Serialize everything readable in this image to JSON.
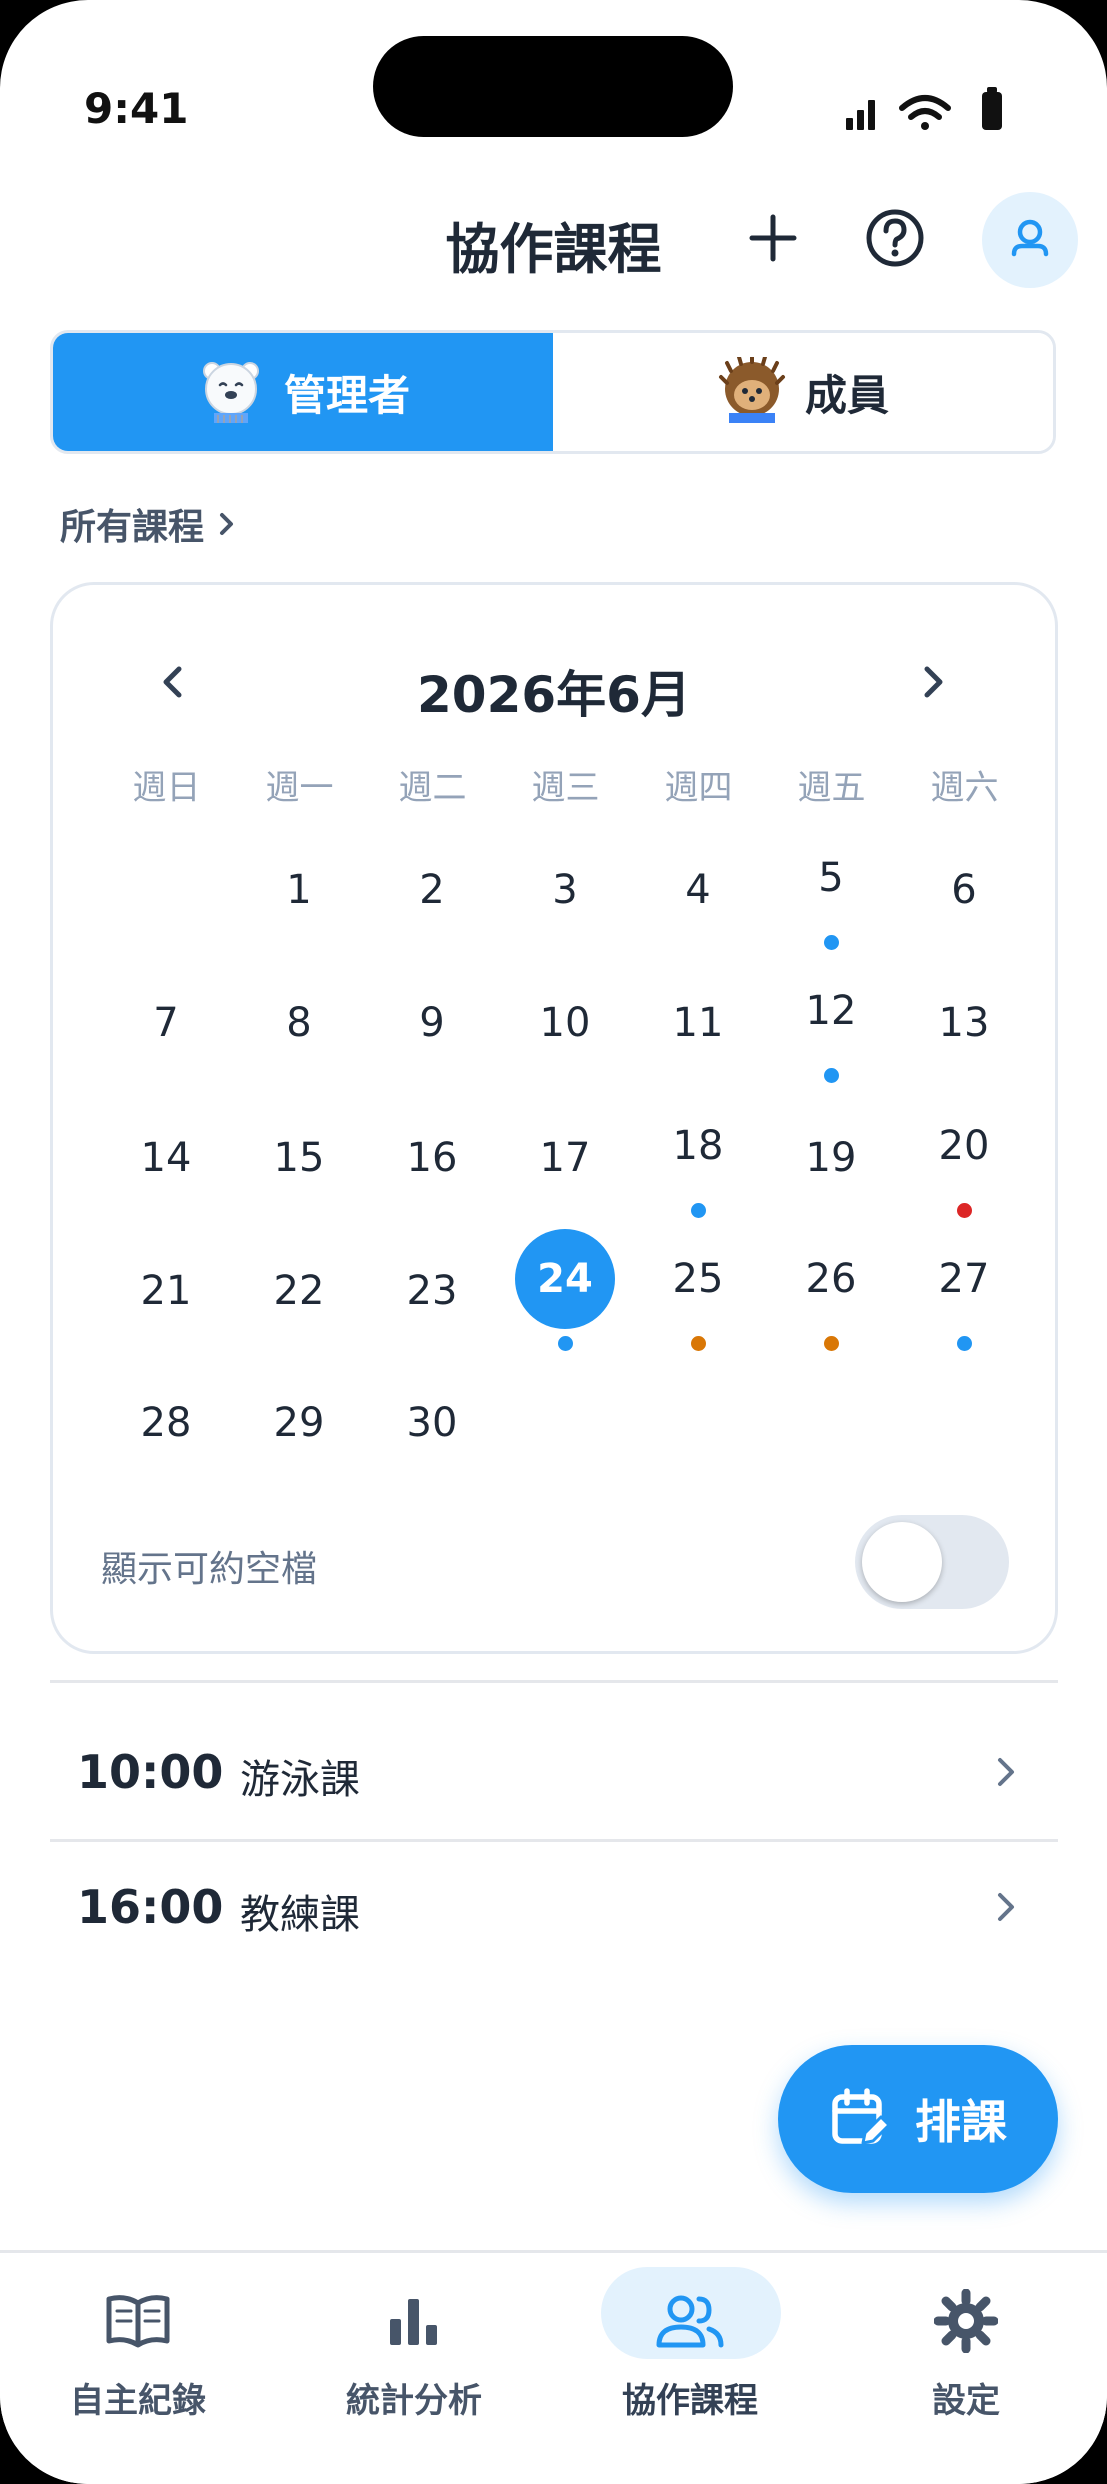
{
  "status_bar": {
    "time": "9:41"
  },
  "header": {
    "title": "協作課程"
  },
  "role_tabs": [
    {
      "label": "管理者",
      "active": true,
      "icon": "polar-bear-icon"
    },
    {
      "label": "成員",
      "active": false,
      "icon": "hedgehog-icon"
    }
  ],
  "all_courses_link": "所有課程",
  "calendar": {
    "month_label": "2026年6月",
    "weekdays": [
      "週日",
      "週一",
      "週二",
      "週三",
      "週四",
      "週五",
      "週六"
    ],
    "selected_day": 24,
    "days": [
      {
        "d": "1"
      },
      {
        "d": "2"
      },
      {
        "d": "3"
      },
      {
        "d": "4"
      },
      {
        "d": "5",
        "dot": "#2196f3"
      },
      {
        "d": "6"
      },
      {
        "d": "7"
      },
      {
        "d": "8"
      },
      {
        "d": "9"
      },
      {
        "d": "10"
      },
      {
        "d": "11"
      },
      {
        "d": "12",
        "dot": "#2196f3"
      },
      {
        "d": "13"
      },
      {
        "d": "14"
      },
      {
        "d": "15"
      },
      {
        "d": "16"
      },
      {
        "d": "17"
      },
      {
        "d": "18",
        "dot": "#2196f3"
      },
      {
        "d": "19"
      },
      {
        "d": "20",
        "dot": "#dc2626"
      },
      {
        "d": "21"
      },
      {
        "d": "22"
      },
      {
        "d": "23"
      },
      {
        "d": "24",
        "dot": "#2196f3",
        "selected": true
      },
      {
        "d": "25",
        "dot": "#d97706"
      },
      {
        "d": "26",
        "dot": "#d97706"
      },
      {
        "d": "27",
        "dot": "#2196f3"
      },
      {
        "d": "28"
      },
      {
        "d": "29"
      },
      {
        "d": "30"
      }
    ],
    "first_weekday_index": 1,
    "show_availability_label": "顯示可約空檔",
    "show_availability": false
  },
  "schedule": [
    {
      "time": "10:00",
      "name": "游泳課"
    },
    {
      "time": "16:00",
      "name": "教練課"
    }
  ],
  "fab": {
    "label": "排課",
    "icon": "calendar-edit-icon"
  },
  "tabbar": [
    {
      "label": "自主紀錄",
      "icon": "book-icon",
      "active": false
    },
    {
      "label": "統計分析",
      "icon": "bar-chart-icon",
      "active": false
    },
    {
      "label": "協作課程",
      "icon": "users-icon",
      "active": true
    },
    {
      "label": "設定",
      "icon": "gear-icon",
      "active": false
    }
  ],
  "colors": {
    "accent": "#2196f3",
    "accent_light": "#e3f2fd",
    "dot_red": "#dc2626",
    "dot_orange": "#d97706"
  }
}
